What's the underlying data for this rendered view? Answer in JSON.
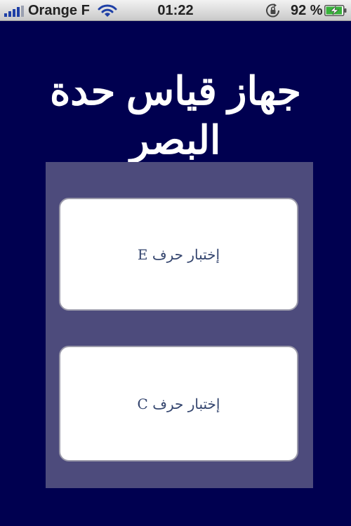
{
  "status_bar": {
    "carrier": "Orange F",
    "time": "01:22",
    "battery_percent": "92 %"
  },
  "page": {
    "title": "جهاز قياس حدة البصر"
  },
  "buttons": {
    "test_e_label": "إختبار حرف E",
    "test_c_label": "إختبار حرف C"
  },
  "colors": {
    "background": "#000050",
    "panel": "#4d4b7c",
    "button_text": "#34456e"
  },
  "icons": {
    "signal": "signal-strength-icon",
    "wifi": "wifi-icon",
    "rotation_lock": "rotation-lock-icon",
    "battery": "battery-charging-icon"
  }
}
